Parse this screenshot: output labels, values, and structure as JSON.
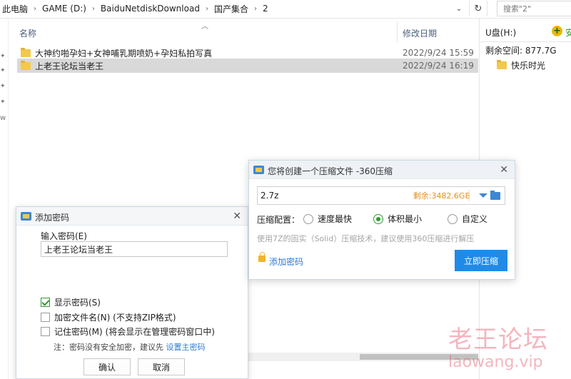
{
  "address_bar": {
    "crumbs": [
      "此电脑",
      "GAME (D:)",
      "BaiduNetdiskDownload",
      "国产集合",
      "2"
    ],
    "search_placeholder": "搜索\"2\""
  },
  "file_list": {
    "columns": {
      "name": "名称",
      "date": "修改日期"
    },
    "rows": [
      {
        "name": "大神约啪孕妇+女神哺乳期喷奶+孕妇私拍写真",
        "date": "2022/9/24 15:59"
      },
      {
        "name": "上老王论坛当老王",
        "date": "2022/9/24 16:19",
        "selected": true
      }
    ]
  },
  "left_nav": {
    "glyph": "w"
  },
  "preview_pane": {
    "drive": "U盘(H:)",
    "cut_text": "安",
    "free_space": "剩余空间: 877.7G",
    "folder": "快乐时光"
  },
  "password_dialog": {
    "title": "添加密码",
    "input_label": "输入密码(E)",
    "password_value": "上老王论坛当老王",
    "show_password": "显示密码(S)",
    "encrypt_filenames": "加密文件名(N) (不支持ZIP格式)",
    "remember_password": "记住密码(M) (将会显示在管理密码窗口中)",
    "note": "注：密码没有安全加密，建议先",
    "note_link": "设置主密码",
    "ok": "确认",
    "cancel": "取消",
    "checked": {
      "show_password": true,
      "encrypt_filenames": false,
      "remember_password": false
    }
  },
  "archive_dialog": {
    "title": "您将创建一个压缩文件 -360压缩",
    "archive_name": "2.7z",
    "free_space": "剩余:3482.6GB",
    "config_label": "压缩配置：",
    "options": [
      "速度最快",
      "体积最小",
      "自定义"
    ],
    "selected_option": "体积最小",
    "hint": "使用7Z的固实（Solid）压缩技术，建议使用360压缩进行解压",
    "add_password": "添加密码",
    "compress_now": "立即压缩"
  },
  "watermark": {
    "cn": "老王论坛",
    "en": "laowang.vip"
  },
  "colors": {
    "accent": "#1f8be9",
    "link": "#2d7bd6",
    "check": "#2e9b2e",
    "free_space": "#e8901a",
    "folder": "#f3c84b",
    "watermark": "#e65a6e"
  }
}
